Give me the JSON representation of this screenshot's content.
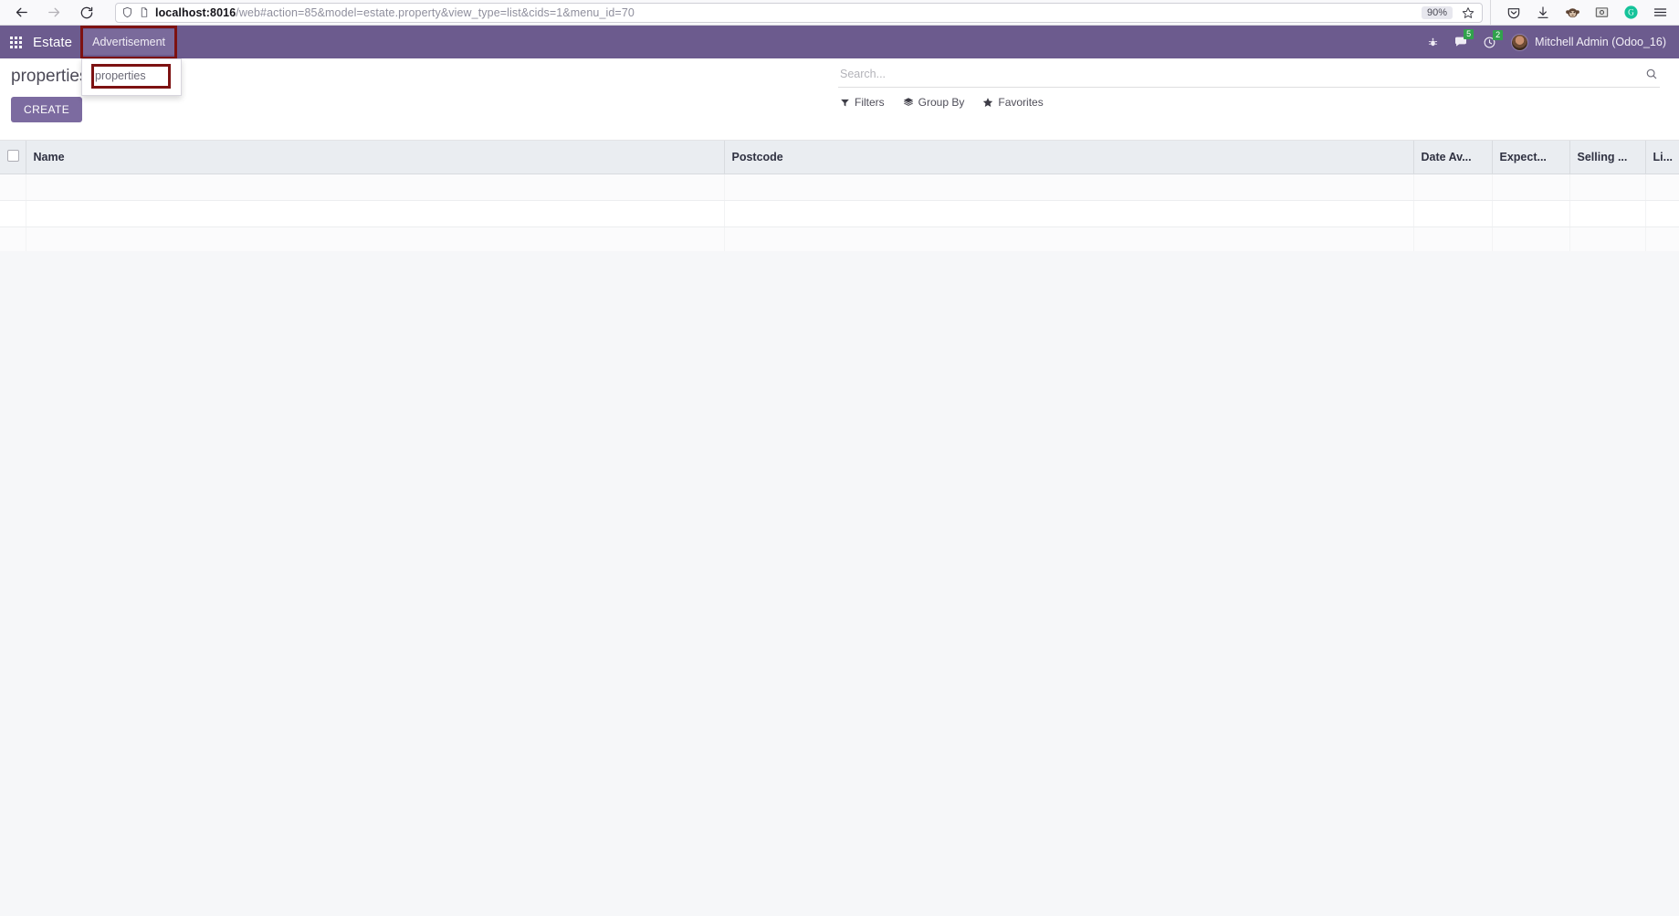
{
  "browser": {
    "back_label": "Back",
    "forward_label": "Forward",
    "reload_label": "Reload",
    "url_host": "localhost:8016",
    "url_path": "/web#action=85&model=estate.property&view_type=list&cids=1&menu_id=70",
    "url_full": "localhost:8016/web#action=85&model=estate.property&view_type=list&cids=1&menu_id=70",
    "zoom_level": "90%",
    "bookmark_label": "Bookmark this page",
    "toolbar_icons": [
      {
        "name": "pocket-icon",
        "label": "Save to Pocket"
      },
      {
        "name": "download-icon",
        "label": "Downloads"
      },
      {
        "name": "monkey-extension-icon",
        "label": "Extension"
      },
      {
        "name": "screenshot-extension-icon",
        "label": "Extension"
      },
      {
        "name": "grammarly-icon",
        "label": "G"
      },
      {
        "name": "hamburger-menu-icon",
        "label": "Open application menu"
      }
    ]
  },
  "navbar": {
    "apps_label": "Apps",
    "brand": "Estate",
    "menus": [
      {
        "label": "Advertisement",
        "active": true,
        "highlighted": true
      }
    ],
    "systray": {
      "debug_label": "Debug",
      "messages_count": "5",
      "activities_count": "2",
      "user_name": "Mitchell Admin (Odoo_16)"
    },
    "highlight_color": "#7d1212",
    "background_color": "#6c5b8e"
  },
  "dropdown": {
    "open": true,
    "items": [
      {
        "label": "properties",
        "highlighted": true
      }
    ]
  },
  "control_panel": {
    "breadcrumb": "properties",
    "create_label": "CREATE",
    "search_placeholder": "Search...",
    "search_value": "",
    "filters": [
      {
        "label": "Filters",
        "icon": "filter-icon"
      },
      {
        "label": "Group By",
        "icon": "layers-icon"
      },
      {
        "label": "Favorites",
        "icon": "star-icon"
      }
    ]
  },
  "list_view": {
    "columns": [
      {
        "label": "Name"
      },
      {
        "label": "Postcode"
      },
      {
        "label": "Date Av..."
      },
      {
        "label": "Expect..."
      },
      {
        "label": "Selling ..."
      },
      {
        "label": "Li..."
      }
    ],
    "rows": [
      {
        "cells": [
          "",
          "",
          "",
          "",
          "",
          ""
        ]
      },
      {
        "cells": [
          "",
          "",
          "",
          "",
          "",
          ""
        ]
      },
      {
        "cells": [
          "",
          "",
          "",
          "",
          "",
          ""
        ]
      },
      {
        "cells": [
          "",
          "",
          "",
          "",
          "",
          ""
        ]
      }
    ]
  }
}
